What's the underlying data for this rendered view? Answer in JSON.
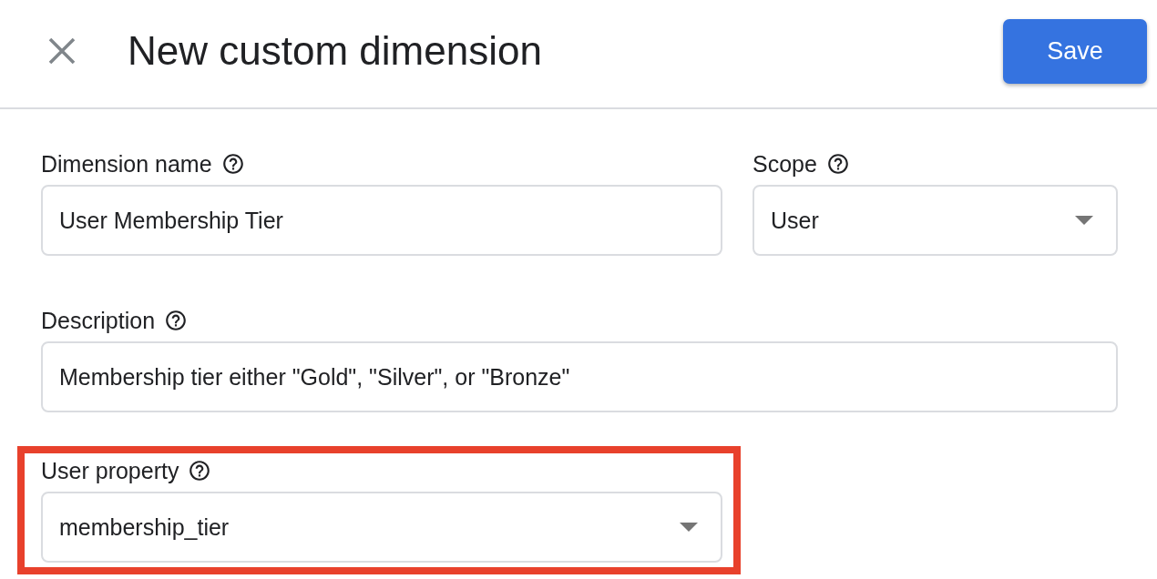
{
  "header": {
    "title": "New custom dimension",
    "save_button": "Save"
  },
  "form": {
    "fields": [
      {
        "kind": "text",
        "label": "Dimension name",
        "value": "User Membership Tier",
        "highlighted": false
      },
      {
        "kind": "select",
        "label": "Scope",
        "value": "User",
        "highlighted": false
      },
      {
        "kind": "text",
        "label": "Description",
        "value": "Membership tier either \"Gold\", \"Silver\", or \"Bronze\"",
        "highlighted": false
      },
      {
        "kind": "select",
        "label": "User property",
        "value": "membership_tier",
        "highlighted": true
      }
    ]
  }
}
